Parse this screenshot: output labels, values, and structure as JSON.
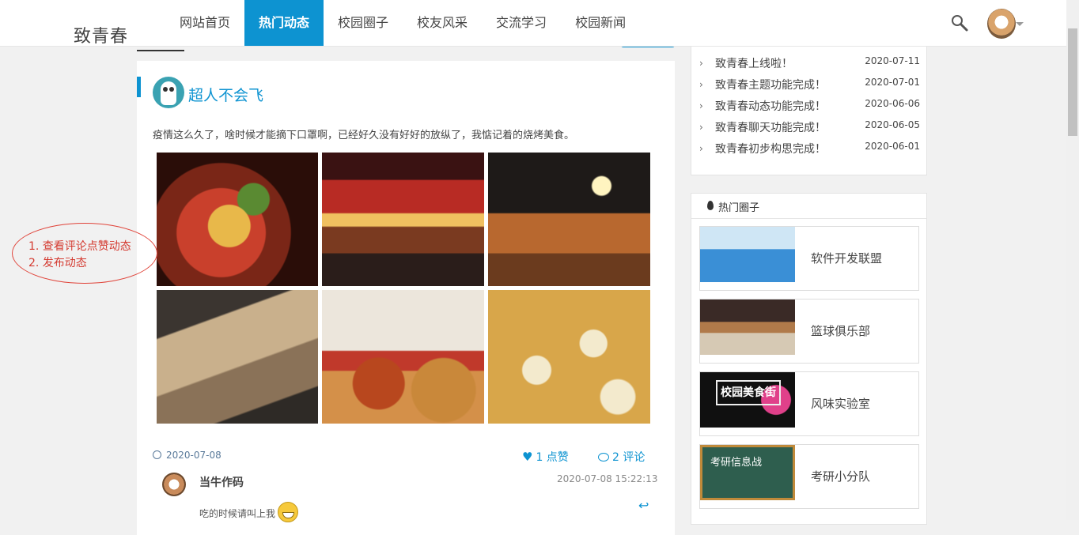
{
  "header": {
    "brand": "致青春",
    "nav": [
      "网站首页",
      "热门动态",
      "校园圈子",
      "校友风采",
      "交流学习",
      "校园新闻"
    ],
    "active_index": 1
  },
  "post": {
    "author": "超人不会飞",
    "content": "疫情这么久了，啥时候才能摘下口罩啊，已经好久没有好好的放纵了，我惦记着的烧烤美食。",
    "date": "2020-07-08",
    "likes_label": "1 点赞",
    "comments_label": "2 评论",
    "photos": [
      "烧烤拼盘",
      "夜市街景",
      "烤串摊位",
      "炸串小吃",
      "烤肠与饼",
      "花式点心"
    ]
  },
  "comment": {
    "user": "当牛作码",
    "time": "2020-07-08 15:22:13",
    "text": "吃的时候请叫上我"
  },
  "annotation": {
    "line1": "1. 查看评论点赞动态",
    "line2": "2. 发布动态"
  },
  "news": [
    {
      "title": "致青春上线啦！",
      "date": "2020-07-11"
    },
    {
      "title": "致青春主题功能完成！",
      "date": "2020-07-01"
    },
    {
      "title": "致青春动态功能完成！",
      "date": "2020-06-06"
    },
    {
      "title": "致青春聊天功能完成！",
      "date": "2020-06-05"
    },
    {
      "title": "致青春初步构思完成！",
      "date": "2020-06-01"
    }
  ],
  "hot_circles": {
    "title": "热门圈子",
    "items": [
      {
        "name": "软件开发联盟"
      },
      {
        "name": "篮球俱乐部"
      },
      {
        "name": "风味实验室",
        "sign": "校园美食街"
      },
      {
        "name": "考研小分队",
        "sign": "考研信息战"
      }
    ]
  },
  "colors": {
    "accent": "#0d93d1",
    "annotation": "#d43a30"
  }
}
